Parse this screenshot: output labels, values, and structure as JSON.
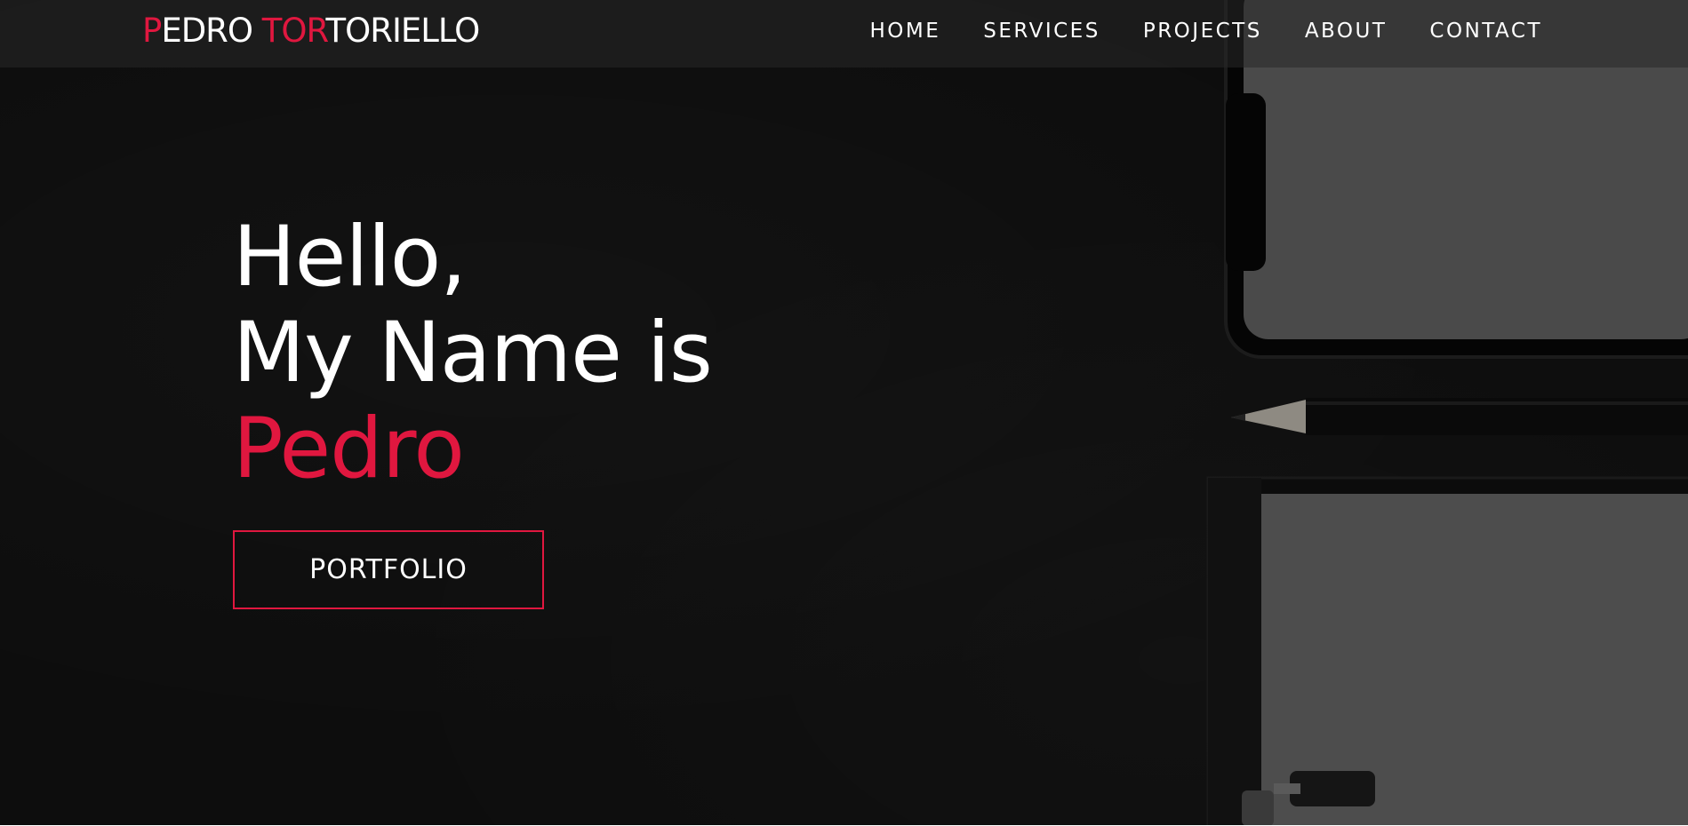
{
  "nav": {
    "logo": {
      "part1_accent": "P",
      "part1_rest": "EDRO ",
      "part2_accent": "TOR",
      "part2_rest": "TORIELLO"
    },
    "links": [
      {
        "label": "HOME"
      },
      {
        "label": "SERVICES"
      },
      {
        "label": "PROJECTS"
      },
      {
        "label": "ABOUT"
      },
      {
        "label": "CONTACT"
      }
    ]
  },
  "hero": {
    "greeting": "Hello,",
    "intro": "My Name is",
    "name": "Pedro",
    "cta_label": "PORTFOLIO"
  },
  "colors": {
    "accent": "#e0173f",
    "background": "#0d0d0d",
    "text": "#ffffff"
  }
}
